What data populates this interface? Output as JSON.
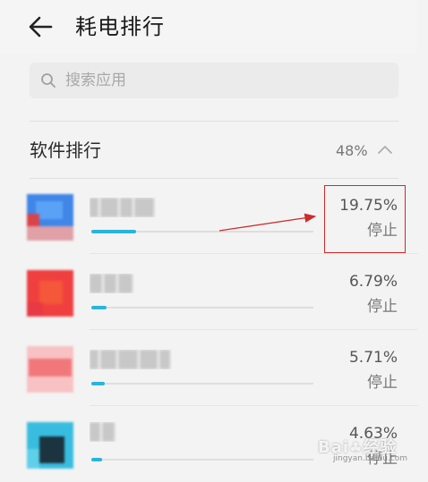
{
  "header": {
    "title": "耗电排行"
  },
  "search": {
    "placeholder": "搜索应用",
    "value": ""
  },
  "section": {
    "title": "软件排行",
    "percent": "48%"
  },
  "apps": [
    {
      "percent": "19.75%",
      "stop_label": "停止",
      "usage_fraction": 0.2,
      "icon_colors": [
        "#3f86e8",
        "#e0a0a6"
      ]
    },
    {
      "percent": "6.79%",
      "stop_label": "停止",
      "usage_fraction": 0.07,
      "icon_colors": [
        "#f03f3f",
        "#f5573a"
      ]
    },
    {
      "percent": "5.71%",
      "stop_label": "停止",
      "usage_fraction": 0.06,
      "icon_colors": [
        "#f1787a",
        "#f8c2c4"
      ]
    },
    {
      "percent": "4.63%",
      "stop_label": "停止",
      "usage_fraction": 0.05,
      "icon_colors": [
        "#38bde0",
        "#1c3440"
      ]
    }
  ],
  "annotation": {
    "color": "#cf2a2a"
  },
  "watermark": {
    "text": "Baidu经验",
    "sub": "jingyan.baidu.com"
  },
  "colors": {
    "accent": "#27b5dc",
    "background": "#f3f3f3"
  }
}
